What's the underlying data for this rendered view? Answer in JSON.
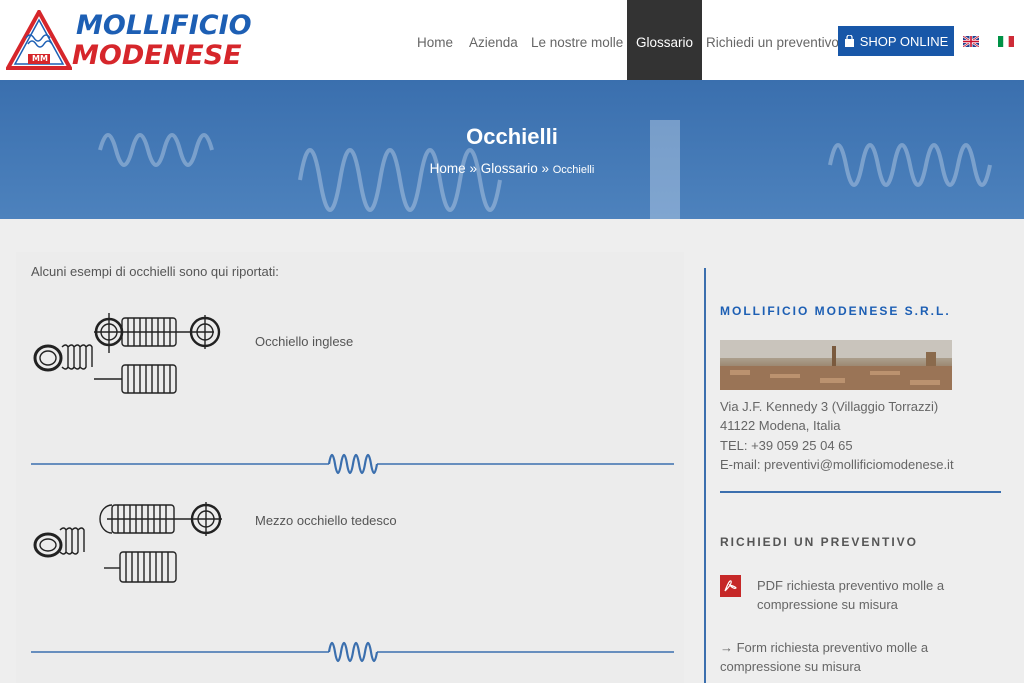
{
  "logo": {
    "line1": "MOLLIFICIO",
    "line2": "MODENESE",
    "badge": "MM"
  },
  "nav": {
    "items": [
      {
        "label": "Home"
      },
      {
        "label": "Azienda"
      },
      {
        "label": "Le nostre molle"
      },
      {
        "label": "Glossario"
      },
      {
        "label": "Richiedi un preventivo"
      }
    ],
    "shop_label": "SHOP ONLINE"
  },
  "banner": {
    "title": "Occhielli",
    "crumb_home": "Home",
    "sep1": " » ",
    "crumb_glossary": "Glossario",
    "sep2": " » ",
    "crumb_current": "Occhielli"
  },
  "content": {
    "intro": "Alcuni esempi di occhielli sono qui riportati:",
    "items": [
      {
        "label": "Occhiello inglese"
      },
      {
        "label": "Mezzo occhiello tedesco"
      }
    ]
  },
  "sidebar": {
    "company_heading": "MOLLIFICIO MODENESE S.R.L.",
    "address1": "Via J.F. Kennedy 3 (Villaggio Torrazzi)",
    "address2": "41122 Modena, Italia",
    "tel": "TEL: +39 059 25 04 65",
    "email": "E-mail: preventivi@mollificiomodenese.it",
    "quote_heading": "RICHIEDI UN PREVENTIVO",
    "pdf_link_1": "PDF richiesta preventivo molle a",
    "pdf_link_2": "compressione su misura",
    "form_link_1": "→ Form richiesta preventivo molle a",
    "form_link_2": "compressione su misura"
  },
  "colors": {
    "brand_blue": "#1d5fb4",
    "brand_red": "#d6262b",
    "nav_active": "#333333",
    "banner": "#3a6fae",
    "heading_blue": "#1d5fb4",
    "heading_dark": "#555555"
  },
  "icons": [
    "shopping-bag-icon",
    "uk-flag-icon",
    "italy-flag-icon",
    "pdf-icon",
    "spring-divider-icon"
  ]
}
